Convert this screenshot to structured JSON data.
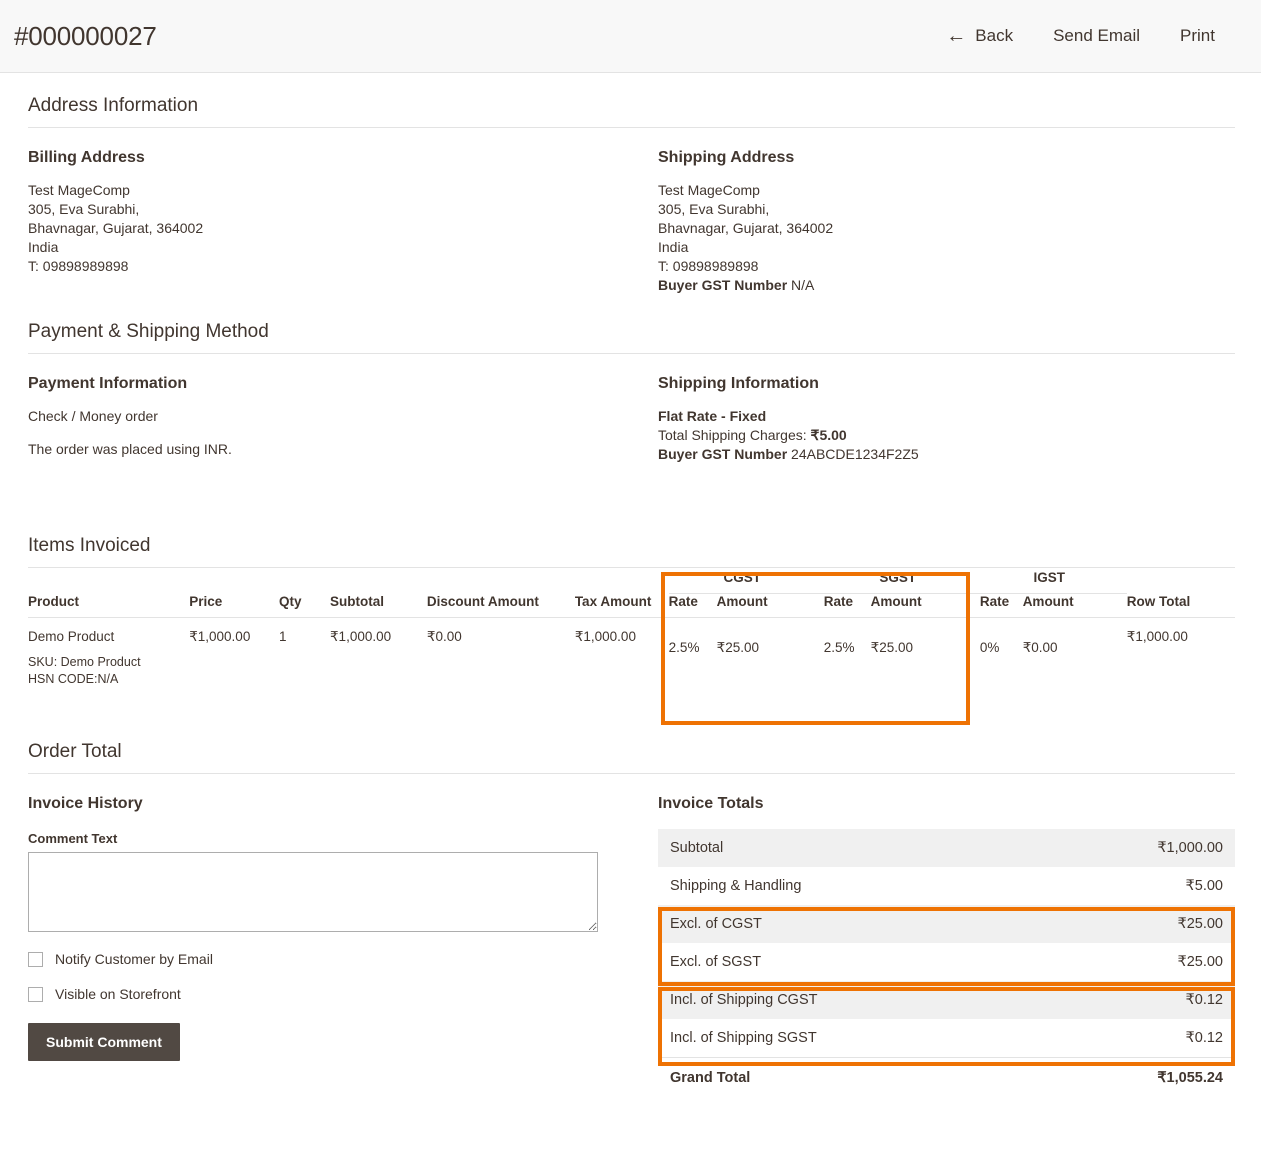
{
  "header": {
    "title": "#000000027",
    "back_label": "Back",
    "back_icon": "arrow-left-icon",
    "send_email_label": "Send Email",
    "print_label": "Print"
  },
  "address_section": {
    "title": "Address Information",
    "billing": {
      "heading": "Billing Address",
      "lines": [
        "Test MageComp",
        "305, Eva Surabhi,",
        "Bhavnagar, Gujarat, 364002",
        "India",
        "T: 09898989898"
      ]
    },
    "shipping": {
      "heading": "Shipping Address",
      "lines": [
        "Test MageComp",
        "305, Eva Surabhi,",
        "Bhavnagar, Gujarat, 364002",
        "India",
        "T: 09898989898"
      ],
      "gst_label": "Buyer GST Number",
      "gst_value": "N/A"
    }
  },
  "payment_section": {
    "title": "Payment & Shipping Method",
    "payment": {
      "heading": "Payment Information",
      "method": "Check / Money order",
      "currency_note": "The order was placed using INR."
    },
    "shipping": {
      "heading": "Shipping Information",
      "method": "Flat Rate - Fixed",
      "charges_label": "Total Shipping Charges:",
      "charges_value": "₹5.00",
      "gst_label": "Buyer GST Number",
      "gst_value": "24ABCDE1234F2Z5"
    }
  },
  "items_section": {
    "title": "Items Invoiced",
    "group_headers": {
      "cgst": "CGST",
      "sgst": "SGST",
      "igst": "IGST"
    },
    "columns": {
      "product": "Product",
      "price": "Price",
      "qty": "Qty",
      "subtotal": "Subtotal",
      "discount": "Discount Amount",
      "tax": "Tax Amount",
      "rate": "Rate",
      "amount": "Amount",
      "row_total": "Row Total"
    },
    "rows": [
      {
        "product": "Demo Product",
        "sku": "SKU: Demo Product",
        "hsn": "HSN CODE:N/A",
        "price": "₹1,000.00",
        "qty": "1",
        "subtotal": "₹1,000.00",
        "discount": "₹0.00",
        "tax": "₹1,000.00",
        "cgst_rate": "2.5%",
        "cgst_amount": "₹25.00",
        "sgst_rate": "2.5%",
        "sgst_amount": "₹25.00",
        "igst_rate": "0%",
        "igst_amount": "₹0.00",
        "row_total": "₹1,000.00"
      }
    ]
  },
  "order_total_section": {
    "title": "Order Total",
    "history": {
      "heading": "Invoice History",
      "comment_label": "Comment Text",
      "comment_value": "",
      "comment_placeholder": "",
      "notify_label": "Notify Customer by Email",
      "notify_checked": false,
      "visible_label": "Visible on Storefront",
      "visible_checked": false,
      "submit_label": "Submit Comment"
    },
    "totals": {
      "heading": "Invoice Totals",
      "rows": [
        {
          "label": "Subtotal",
          "value": "₹1,000.00"
        },
        {
          "label": "Shipping & Handling",
          "value": "₹5.00"
        },
        {
          "label": "Excl. of CGST",
          "value": "₹25.00"
        },
        {
          "label": "Excl. of SGST",
          "value": "₹25.00"
        },
        {
          "label": "Incl. of Shipping CGST",
          "value": "₹0.12"
        },
        {
          "label": "Incl. of Shipping SGST",
          "value": "₹0.12"
        }
      ],
      "grand_total_label": "Grand Total",
      "grand_total_value": "₹1,055.24"
    }
  },
  "colors": {
    "highlight": "#ee7203",
    "button": "#514943",
    "header_bg": "#f8f8f8",
    "row_shade": "#f0f0f0",
    "text": "#41362f"
  }
}
